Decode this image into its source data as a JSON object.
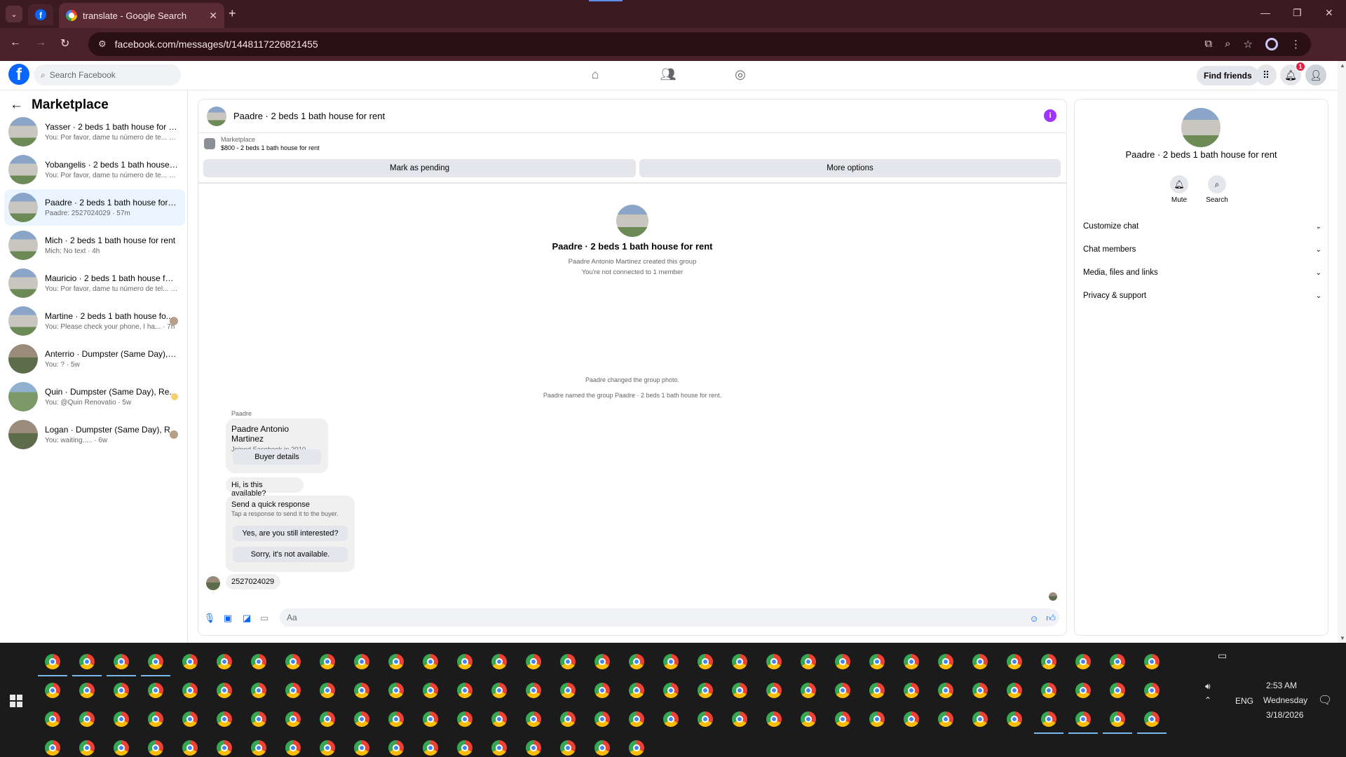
{
  "browser": {
    "tab_title": "translate - Google Search",
    "url": "facebook.com/messages/t/1448117226821455"
  },
  "facebook": {
    "search_placeholder": "Search Facebook",
    "find_friends_label": "Find friends",
    "notification_count": "1"
  },
  "sidebar": {
    "title": "Marketplace",
    "conversations": [
      {
        "name": "Yasser · 2 beds 1 bath house for rent",
        "snippet": "You: Por favor, dame tu número de te... · 1m",
        "thumb": "house"
      },
      {
        "name": "Yobangelis · 2 beds 1 bath house f...",
        "snippet": "You: Por favor, dame tu número de te... · 1m",
        "thumb": "house"
      },
      {
        "name": "Paadre · 2 beds 1 bath house for re...",
        "snippet": "Paadre: 2527024029 · 57m",
        "thumb": "house"
      },
      {
        "name": "Mich · 2 beds 1 bath house for rent",
        "snippet": "Mich: No text · 4h",
        "thumb": "house"
      },
      {
        "name": "Mauricio · 2 beds 1 bath house for ...",
        "snippet": "You: Por favor, dame tu número de tel... · 6h",
        "thumb": "house"
      },
      {
        "name": "Martine · 2 beds 1 bath house fo...",
        "snippet": "You: Please check your phone, I ha... · 7h",
        "thumb": "house"
      },
      {
        "name": "Anterrio · Dumpster (Same Day), R...",
        "snippet": "You: ? · 5w",
        "thumb": "person"
      },
      {
        "name": "Quin · Dumpster (Same Day), Re...",
        "snippet": "You: @Quin Renovatio · 5w",
        "thumb": "field"
      },
      {
        "name": "Logan · Dumpster (Same Day), R...",
        "snippet": "You: waiting..... · 6w",
        "thumb": "person"
      }
    ]
  },
  "chat": {
    "title": "Paadre · 2 beds 1 bath house for rent",
    "marketplace_label": "Marketplace",
    "listing": "$800 - 2 beds 1 bath house for rent",
    "mark_pending": "Mark as pending",
    "more_options": "More options",
    "group_name": "Paadre · 2 beds 1 bath house for rent",
    "created_note": "Paadre Antonio Martinez created this group",
    "connection_note": "You're not connected to 1 member",
    "event_photo": "Paadre changed the group photo.",
    "event_name": "Paadre named the group Paadre · 2 beds 1 bath house for rent.",
    "sender_label": "Paadre",
    "buyer_name": "Paadre Antonio Martinez",
    "buyer_joined": "Joined Facebook in 2010",
    "buyer_details": "Buyer details",
    "question": "Hi, is this available?",
    "quick_title": "Send a quick response",
    "quick_sub": "Tap a response to send it to the buyer.",
    "quick_yes": "Yes, are you still interested?",
    "quick_no": "Sorry, it's not available.",
    "phone_msg": "2527024029",
    "composer_placeholder": "Aa"
  },
  "right_panel": {
    "title": "Paadre · 2 beds 1 bath house for rent",
    "mute_label": "Mute",
    "search_label": "Search",
    "rows": [
      "Customize chat",
      "Chat members",
      "Media, files and links",
      "Privacy & support"
    ]
  },
  "taskbar": {
    "lang": "ENG",
    "time": "2:53 AM",
    "day": "Wednesday",
    "date": "3/18/2026"
  },
  "colors": {
    "fb_blue": "#0866ff",
    "browser_frame": "#4a222b",
    "active_conv": "#ebf5ff",
    "info_purple": "#a033ff"
  }
}
